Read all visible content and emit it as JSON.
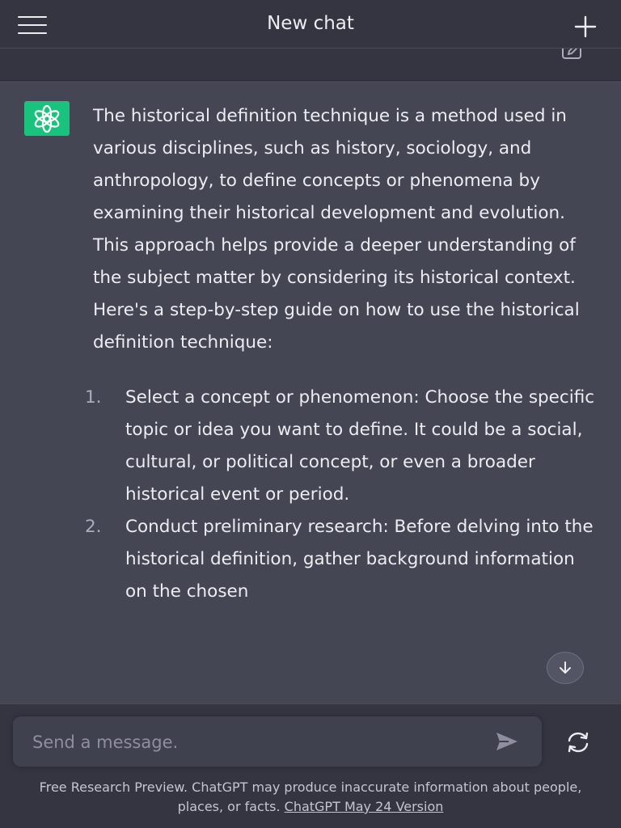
{
  "header": {
    "title": "New chat"
  },
  "message": {
    "intro": "The historical definition technique is a method used in various disciplines, such as history, sociology, and anthropology, to define concepts or phenomena by examining their historical development and evolution. This approach helps provide a deeper understanding of the subject matter by considering its historical context. Here's a step-by-step guide on how to use the historical definition technique:",
    "steps": [
      {
        "number": "1.",
        "text": "Select a concept or phenomenon: Choose the specific topic or idea you want to define. It could be a social, cultural, or political concept, or even a broader historical event or period."
      },
      {
        "number": "2.",
        "text": "Conduct preliminary research: Before delving into the historical definition, gather background information on the chosen"
      }
    ]
  },
  "composer": {
    "placeholder": "Send a message."
  },
  "disclaimer": {
    "text": "Free Research Preview. ChatGPT may produce inaccurate information about people, places, or facts. ",
    "link_label": "ChatGPT May 24 Version"
  },
  "colors": {
    "background": "#343541",
    "message_background": "#444654",
    "avatar_green": "#19c37d",
    "input_background": "#40414f",
    "text": "#ececf1"
  },
  "icons": {
    "menu": "hamburger-menu-icon",
    "new_chat": "plus-icon",
    "edit": "edit-icon",
    "avatar": "openai-logo-icon",
    "scroll": "arrow-down-icon",
    "send": "paper-plane-icon",
    "regenerate": "refresh-icon"
  }
}
